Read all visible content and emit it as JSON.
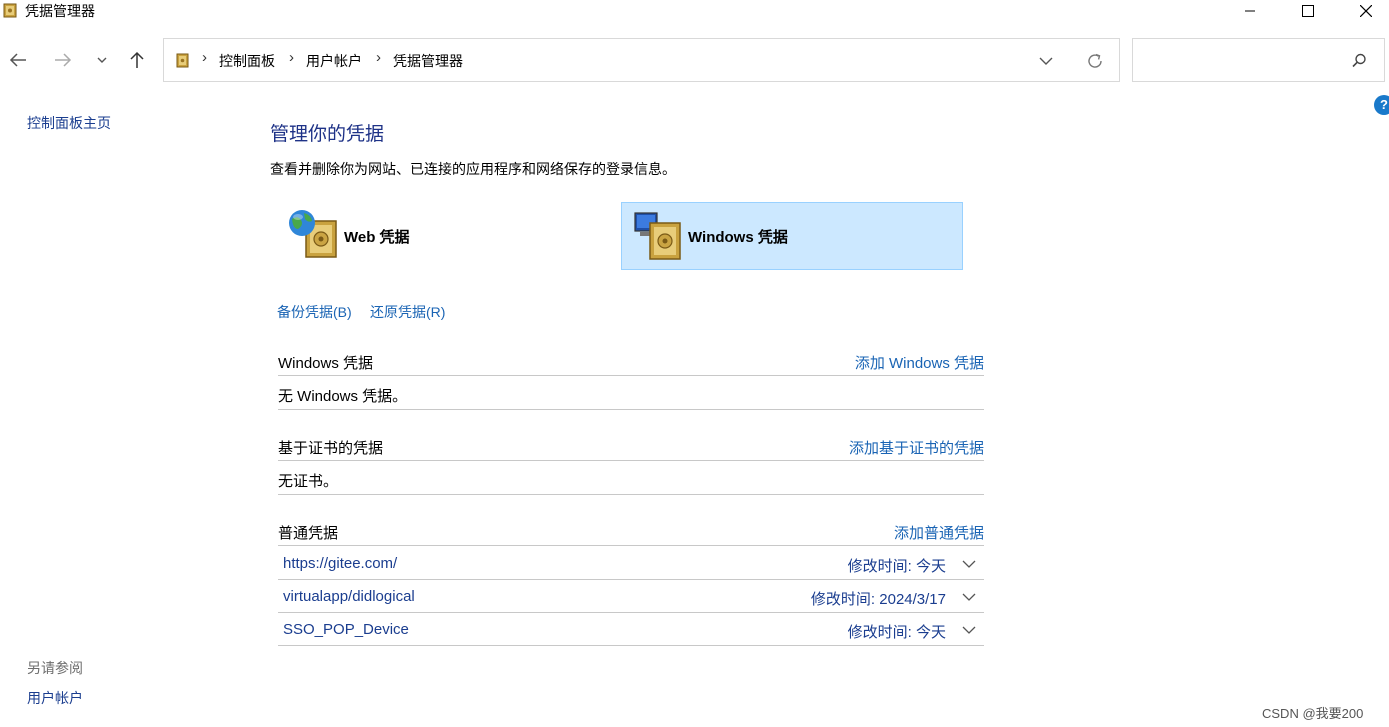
{
  "window": {
    "title": "凭据管理器"
  },
  "address": {
    "breadcrumbs": [
      "控制面板",
      "用户帐户",
      "凭据管理器"
    ],
    "separator": "›"
  },
  "search": {
    "placeholder": ""
  },
  "help": {
    "label": "?"
  },
  "sidebar": {
    "home_link": "控制面板主页",
    "see_also_heading": "另请参阅",
    "see_also_links": [
      "用户帐户"
    ]
  },
  "main": {
    "title": "管理你的凭据",
    "description": "查看并删除你为网站、已连接的应用程序和网络保存的登录信息。",
    "credential_types": [
      {
        "label": "Web 凭据",
        "selected": false
      },
      {
        "label": "Windows 凭据",
        "selected": true
      }
    ],
    "actions": [
      "备份凭据(B)",
      "还原凭据(R)"
    ],
    "sections": [
      {
        "title": "Windows 凭据",
        "add_link": "添加 Windows 凭据",
        "empty_text": "无 Windows 凭据。"
      },
      {
        "title": "基于证书的凭据",
        "add_link": "添加基于证书的凭据",
        "empty_text": "无证书。"
      },
      {
        "title": "普通凭据",
        "add_link": "添加普通凭据",
        "items": [
          {
            "name": "https://gitee.com/",
            "modified": "修改时间:  今天"
          },
          {
            "name": "virtualapp/didlogical",
            "modified": "修改时间:  2024/3/17"
          },
          {
            "name": "SSO_POP_Device",
            "modified": "修改时间:  今天"
          }
        ]
      }
    ]
  },
  "watermark": "CSDN @我要200",
  "colors": {
    "link": "#1a64b4",
    "title": "#1e3287",
    "selected_bg": "#cce8ff",
    "selected_border": "#99d1ff"
  }
}
